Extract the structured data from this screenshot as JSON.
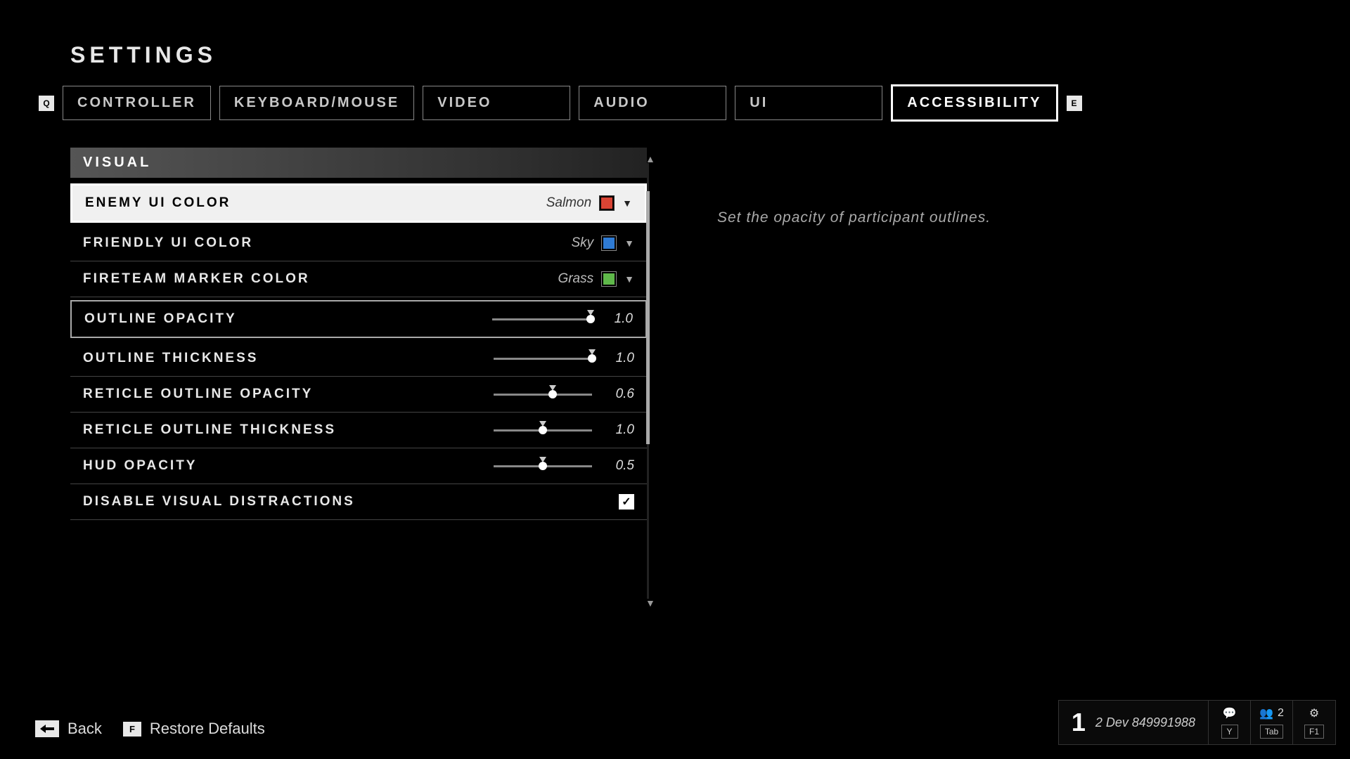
{
  "page_title": "SETTINGS",
  "tabs": {
    "left_hint": "Q",
    "right_hint": "E",
    "items": [
      "CONTROLLER",
      "KEYBOARD/MOUSE",
      "VIDEO",
      "AUDIO",
      "UI",
      "ACCESSIBILITY"
    ],
    "active_index": 5
  },
  "section_header": "VISUAL",
  "description": "Set the opacity of participant outlines.",
  "options": {
    "enemy_color": {
      "label": "ENEMY UI COLOR",
      "value": "Salmon",
      "swatch": "#d84434"
    },
    "friendly_color": {
      "label": "FRIENDLY UI COLOR",
      "value": "Sky",
      "swatch": "#2f7bd4"
    },
    "fireteam_color": {
      "label": "FIRETEAM MARKER COLOR",
      "value": "Grass",
      "swatch": "#5fb84a"
    },
    "outline_opacity": {
      "label": "OUTLINE OPACITY",
      "value": "1.0",
      "pct": 100
    },
    "outline_thickness": {
      "label": "OUTLINE THICKNESS",
      "value": "1.0",
      "pct": 100
    },
    "reticle_opacity": {
      "label": "RETICLE OUTLINE OPACITY",
      "value": "0.6",
      "pct": 60
    },
    "reticle_thickness": {
      "label": "RETICLE OUTLINE THICKNESS",
      "value": "1.0",
      "pct": 50
    },
    "hud_opacity": {
      "label": "HUD OPACITY",
      "value": "0.5",
      "pct": 50
    },
    "disable_distractions": {
      "label": "DISABLE VISUAL DISTRACTIONS",
      "checked": true
    }
  },
  "footer": {
    "back_label": "Back",
    "restore_key": "F",
    "restore_label": "Restore Defaults"
  },
  "status_bar": {
    "big_num": "1",
    "id_text": "2 Dev 849991988",
    "party_count": "2",
    "keys": {
      "chat": "Y",
      "social": "Tab",
      "settings": "F1"
    }
  }
}
